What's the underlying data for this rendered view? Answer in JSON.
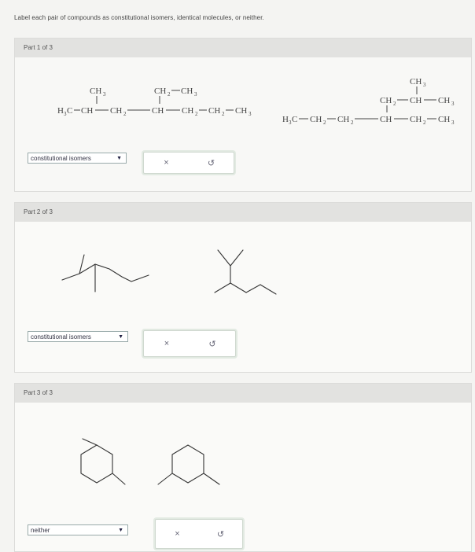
{
  "instructions": "Label each pair of compounds as constitutional isomers, identical molecules, or neither.",
  "parts": [
    {
      "header": "Part 1 of 3",
      "selected": "constitutional isomers",
      "clear": "×",
      "reset": "↺"
    },
    {
      "header": "Part 2 of 3",
      "selected": "constitutional isomers",
      "clear": "×",
      "reset": "↺"
    },
    {
      "header": "Part 3 of 3",
      "selected": "neither",
      "clear": "×",
      "reset": "↺"
    }
  ],
  "dropdown_arrow": "▼",
  "colors": {
    "background": "#f4f4f2",
    "panel": "#ececea",
    "header": "#e2e2e0",
    "button_border": "#cfd8cf"
  },
  "icons": {
    "clear": "x-icon",
    "reset": "undo-icon",
    "dropdown": "caret-down-icon"
  }
}
